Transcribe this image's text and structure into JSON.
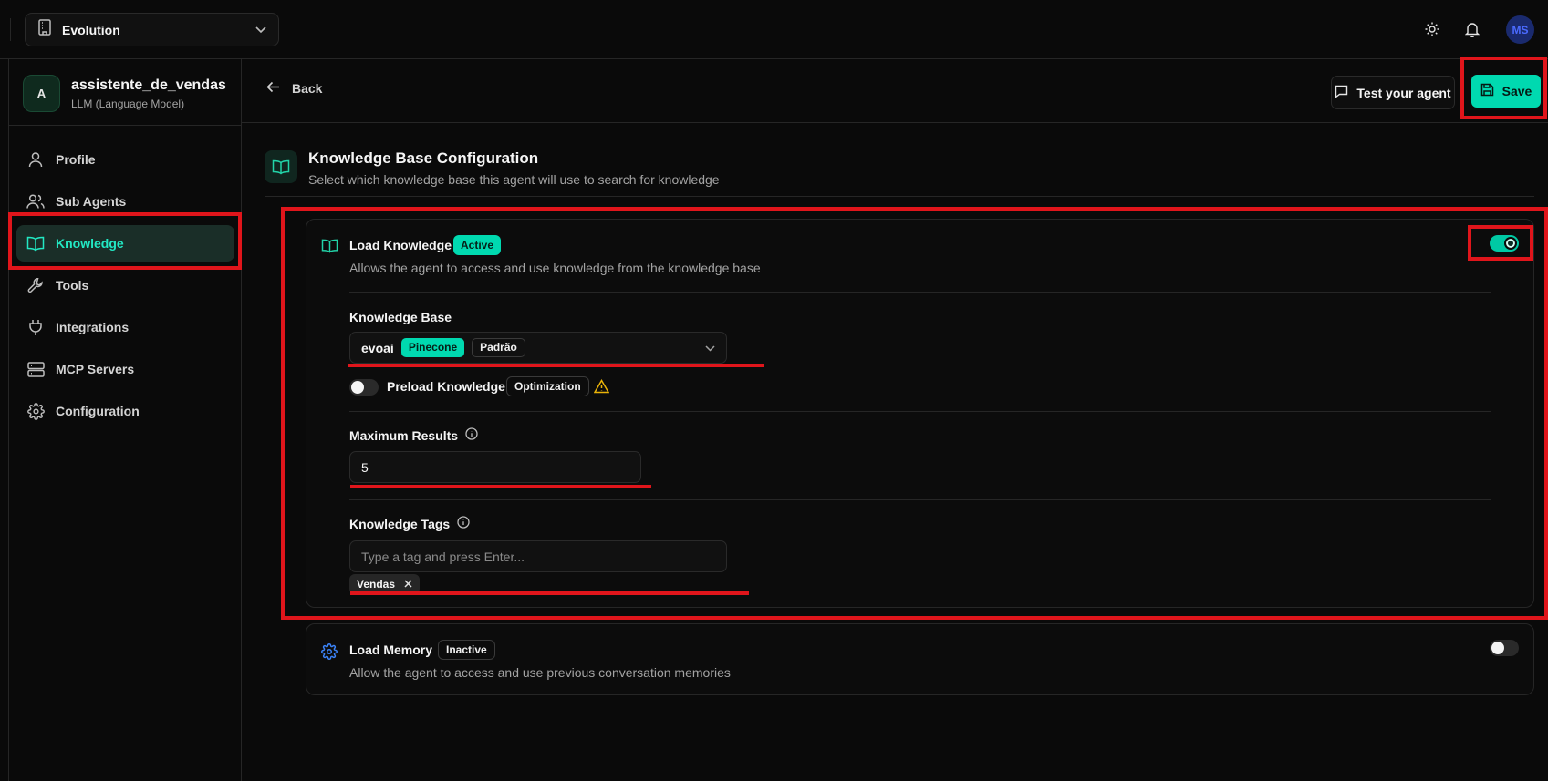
{
  "topbar": {
    "org_name": "Evolution",
    "user_initials": "MS"
  },
  "agent": {
    "avatar_letter": "A",
    "name": "assistente_de_vendas",
    "type": "LLM (Language Model)"
  },
  "sidebar": {
    "items": [
      {
        "label": "Profile",
        "icon": "user-icon"
      },
      {
        "label": "Sub Agents",
        "icon": "users-icon"
      },
      {
        "label": "Knowledge",
        "icon": "book-icon",
        "active": true
      },
      {
        "label": "Tools",
        "icon": "wrench-icon"
      },
      {
        "label": "Integrations",
        "icon": "plug-icon"
      },
      {
        "label": "MCP Servers",
        "icon": "server-icon"
      },
      {
        "label": "Configuration",
        "icon": "gear-icon"
      }
    ]
  },
  "header": {
    "back_label": "Back",
    "test_label": "Test your agent",
    "save_label": "Save"
  },
  "section": {
    "title": "Knowledge Base Configuration",
    "subtitle": "Select which knowledge base this agent will use to search for knowledge"
  },
  "load_knowledge": {
    "title": "Load Knowledge",
    "status": "Active",
    "enabled": true,
    "description": "Allows the agent to access and use knowledge from the knowledge base",
    "knowledge_base_label": "Knowledge Base",
    "knowledge_base_value": "evoai",
    "knowledge_base_provider": "Pinecone",
    "knowledge_base_default": "Padrão",
    "preload_label": "Preload Knowledge",
    "preload_enabled": false,
    "preload_badge": "Optimization",
    "max_results_label": "Maximum Results",
    "max_results_value": "5",
    "tags_label": "Knowledge Tags",
    "tags_placeholder": "Type a tag and press Enter...",
    "tags": [
      "Vendas"
    ]
  },
  "load_memory": {
    "title": "Load Memory",
    "status": "Inactive",
    "enabled": false,
    "description": "Allow the agent to access and use previous conversation memories"
  },
  "colors": {
    "accent": "#00d9b0",
    "annotation": "#e0151b",
    "background": "#0a0a0a"
  }
}
